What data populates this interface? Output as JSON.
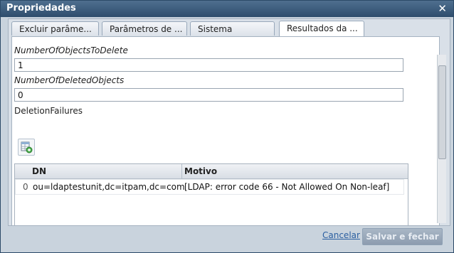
{
  "window": {
    "title": "Propriedades"
  },
  "tabs": [
    {
      "label": "Excluir parâme..."
    },
    {
      "label": "Parâmetros de ..."
    },
    {
      "label": "Sistema"
    },
    {
      "label": "Resultados da ..."
    }
  ],
  "active_tab": 3,
  "fields": {
    "objects_to_delete_label": "NumberOfObjectsToDelete",
    "objects_to_delete_value": "1",
    "deleted_objects_label": "NumberOfDeletedObjects",
    "deleted_objects_value": "0",
    "deletion_failures_label": "DeletionFailures"
  },
  "table": {
    "headers": [
      "DN",
      "Motivo"
    ],
    "rows": [
      {
        "index": "0",
        "dn": "ou=ldaptestunit,dc=itpam,dc=com",
        "reason": "[LDAP: error code 66 - Not Allowed On Non-leaf]"
      }
    ]
  },
  "footer": {
    "cancel_label": "Cancelar",
    "save_label": "Salvar e fechar"
  },
  "icons": [
    "close-icon",
    "export-table-icon"
  ],
  "colors": {
    "titlebar": "#3a5a7a",
    "accent": "#2a5ea0"
  }
}
